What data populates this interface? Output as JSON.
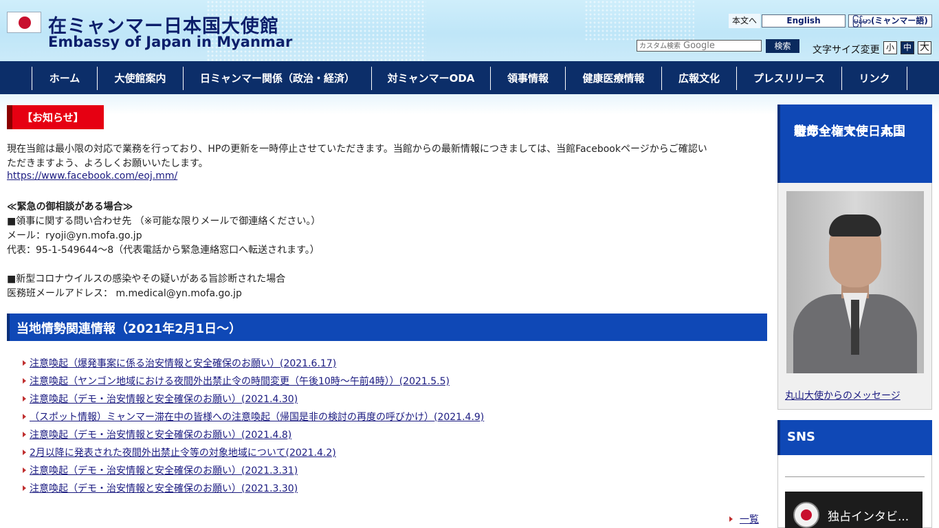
{
  "header": {
    "title_ja": "在ミャンマー日本国大使館",
    "title_en": "Embassy of Japan in Myanmar",
    "skip_link": "本文へ",
    "lang_en": "English",
    "lang_my": "မြန်မာ(ミャンマー語)",
    "search_placeholder": "カスタム検索",
    "search_brand": "Google",
    "search_button": "検索",
    "fontsize_label": "文字サイズ変更",
    "fontsize_small": "小",
    "fontsize_medium": "中",
    "fontsize_large": "大"
  },
  "nav": {
    "items": [
      {
        "label": "ホーム"
      },
      {
        "label": "大使館案内"
      },
      {
        "label": "日ミャンマー関係（政治・経済）"
      },
      {
        "label": "対ミャンマーODA"
      },
      {
        "label": "領事情報"
      },
      {
        "label": "健康医療情報"
      },
      {
        "label": "広報文化"
      },
      {
        "label": "プレスリリース"
      },
      {
        "label": "リンク"
      }
    ]
  },
  "notice": {
    "tab": "【お知らせ】",
    "line1": "現在当館は最小限の対応で業務を行っており、HPの更新を一時停止させていただきます。当館からの最新情報につきましては、当館Facebookページからご確認い",
    "line2": "ただきますよう、よろしくお願いいたします。",
    "facebook_url": "https://www.facebook.com/eoj.mm/",
    "emergency_heading": "≪緊急の御相談がある場合≫",
    "consular_line": "■領事に関する問い合わせ先 （※可能な限りメールで御連絡ください。）",
    "mail_line": "メール：ryoji@yn.mofa.go.jp",
    "phone_line": "代表：95-1-549644～8（代表電話から緊急連絡窓口へ転送されます。）",
    "covid_line": "■新型コロナウイルスの感染やその疑いがある旨診断された場合",
    "medical_line": "医務班メールアドレス： m.medical@yn.mofa.go.jp"
  },
  "local_info": {
    "heading": "当地情勢関連情報（2021年2月1日～）",
    "items": [
      {
        "label": "注意喚起（爆発事案に係る治安情報と安全確保のお願い）(2021.6.17)"
      },
      {
        "label": "注意喚起（ヤンゴン地域における夜間外出禁止令の時間変更（午後10時～午前4時））(2021.5.5)"
      },
      {
        "label": "注意喚起（デモ・治安情報と安全確保のお願い）(2021.4.30)"
      },
      {
        "label": "（スポット情報）ミャンマー滞在中の皆様への注意喚起（帰国是非の検討の再度の呼びかけ）(2021.4.9)"
      },
      {
        "label": "注意喚起（デモ・治安情報と安全確保のお願い）(2021.4.8)"
      },
      {
        "label": "2月以降に発表された夜間外出禁止令等の対象地域について(2021.4.2)"
      },
      {
        "label": "注意喚起（デモ・治安情報と安全確保のお願い）(2021.3.31)"
      },
      {
        "label": "注意喚起（デモ・治安情報と安全確保のお願い）(2021.3.30)"
      }
    ],
    "more": "一覧"
  },
  "sidebar": {
    "ambassador_line1": "駐ミャンマー日本国",
    "ambassador_line2": "特命全権大使　丸山",
    "ambassador_line3": "市郎",
    "ambassador_link": "丸山大使からのメッセージ",
    "sns_heading": "SNS",
    "video_title": "独占インタビ..."
  }
}
